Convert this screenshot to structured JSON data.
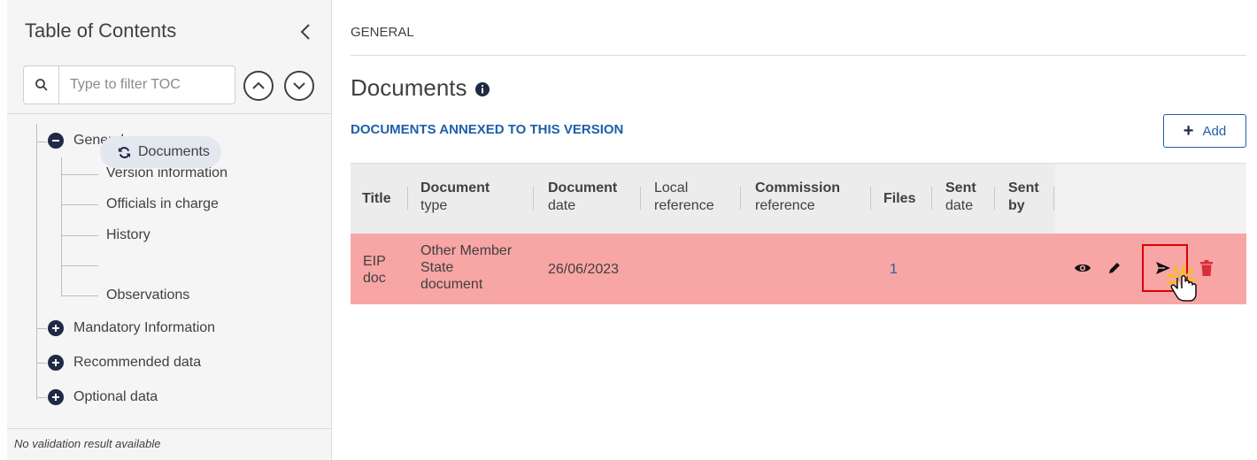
{
  "sidebar": {
    "title": "Table of Contents",
    "filter_placeholder": "Type to filter TOC",
    "items": [
      {
        "label": "General",
        "expanded": true
      },
      {
        "label": "Mandatory Information",
        "expanded": false
      },
      {
        "label": "Recommended data",
        "expanded": false
      },
      {
        "label": "Optional data",
        "expanded": false
      }
    ],
    "general_children": [
      "Version information",
      "Officials in charge",
      "History",
      "Documents",
      "Observations"
    ],
    "active_child": "Documents",
    "validation_text": "No validation result available"
  },
  "main": {
    "section_label": "GENERAL",
    "page_title": "Documents",
    "subtitle": "DOCUMENTS ANNEXED TO THIS VERSION",
    "add_label": "Add",
    "table": {
      "columns": [
        "Title",
        "Document type",
        "Document date",
        "Local reference",
        "Commission reference",
        "Files",
        "Sent date",
        "Sent by"
      ],
      "columns_lines": [
        [
          "Title"
        ],
        [
          "Document",
          "type"
        ],
        [
          "Document",
          "date"
        ],
        [
          "Local",
          "reference"
        ],
        [
          "Commission",
          "reference"
        ],
        [
          "Files"
        ],
        [
          "Sent",
          "date"
        ],
        [
          "Sent",
          "by"
        ]
      ],
      "rows": [
        {
          "title_lines": [
            "EIP",
            "doc"
          ],
          "doc_type_lines": [
            "Other Member",
            "State",
            "document"
          ],
          "document_date": "26/06/2023",
          "local_reference": "",
          "commission_reference": "",
          "files": "1",
          "sent_date": "",
          "sent_by": ""
        }
      ],
      "row_actions": [
        "view-icon",
        "edit-icon",
        "send-icon",
        "delete-icon"
      ]
    }
  },
  "colors": {
    "accent": "#1f5fa8",
    "row_highlight": "#f8a5a5",
    "delete": "#d6303a",
    "highlight_box": "#d90000"
  }
}
